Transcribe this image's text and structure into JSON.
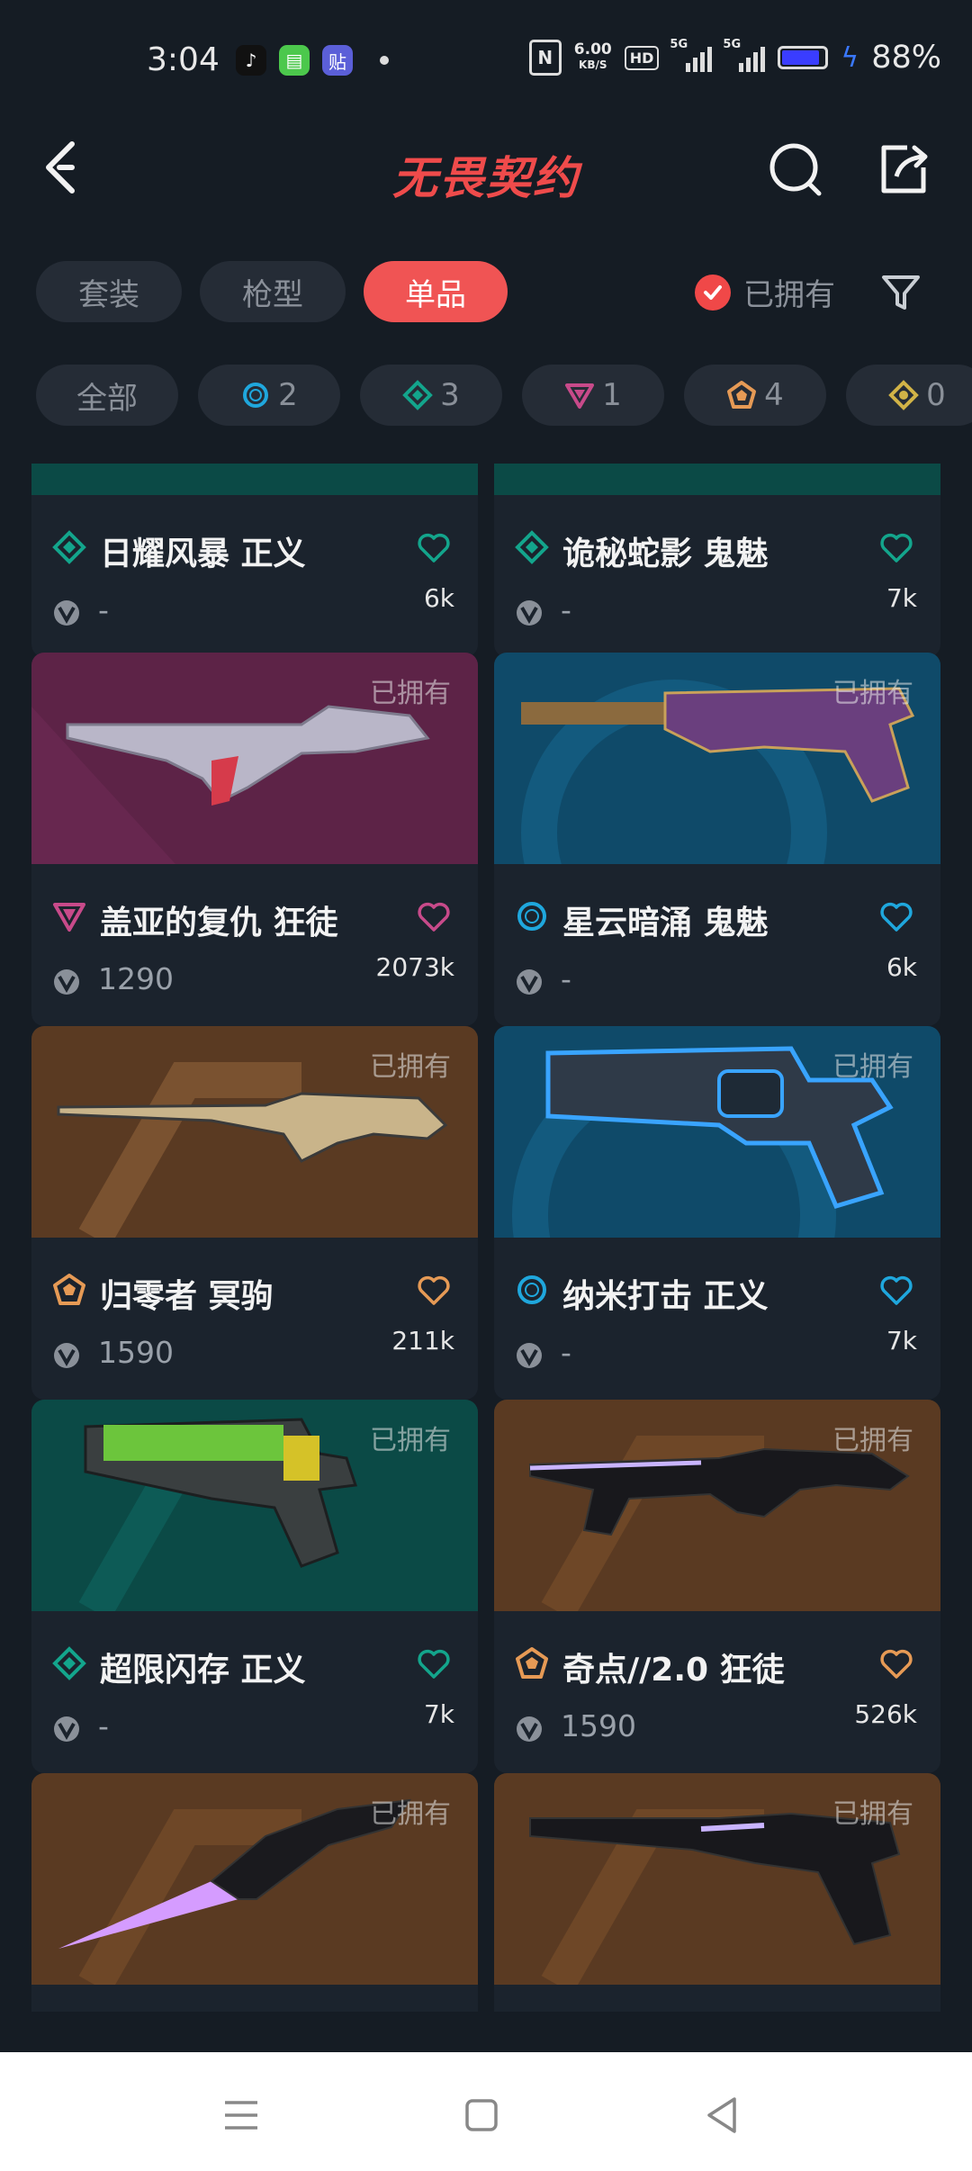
{
  "status_bar": {
    "time": "3:04",
    "speed_value": "6.00",
    "speed_unit": "KB/S",
    "hd_label": "HD",
    "network_1": "5G",
    "network_2": "5G",
    "battery_level": 0.88,
    "battery_text": "88%"
  },
  "header": {
    "title": "无畏契约"
  },
  "tabs": [
    {
      "label": "套装",
      "active": false
    },
    {
      "label": "枪型",
      "active": false
    },
    {
      "label": "单品",
      "active": true
    }
  ],
  "owned_filter": {
    "label": "已拥有",
    "checked": true
  },
  "rarity_chips": [
    {
      "label": "全部",
      "count": ""
    },
    {
      "label": "",
      "count": "2",
      "tier": "select"
    },
    {
      "label": "",
      "count": "3",
      "tier": "deluxe"
    },
    {
      "label": "",
      "count": "1",
      "tier": "premium"
    },
    {
      "label": "",
      "count": "4",
      "tier": "exclusive"
    },
    {
      "label": "",
      "count": "0",
      "tier": "ultra"
    }
  ],
  "colors": {
    "select": "#1fa7dd",
    "deluxe": "#13a58c",
    "premium": "#c84a8a",
    "exclusive": "#e69a55",
    "ultra": "#d1b347",
    "accent": "#f05454"
  },
  "items": [
    {
      "name": "日耀风暴 正义",
      "tier": "deluxe",
      "price": "-",
      "likes": "6k",
      "owned_label": ""
    },
    {
      "name": "诡秘蛇影 鬼魅",
      "tier": "deluxe",
      "price": "-",
      "likes": "7k",
      "owned_label": ""
    },
    {
      "name": "盖亚的复仇 狂徒",
      "tier": "premium",
      "price": "1290",
      "likes": "2073k",
      "owned_label": "已拥有"
    },
    {
      "name": "星云暗涌 鬼魅",
      "tier": "select",
      "price": "-",
      "likes": "6k",
      "owned_label": "已拥有"
    },
    {
      "name": "归零者 冥驹",
      "tier": "exclusive",
      "price": "1590",
      "likes": "211k",
      "owned_label": "已拥有"
    },
    {
      "name": "纳米打击 正义",
      "tier": "select",
      "price": "-",
      "likes": "7k",
      "owned_label": "已拥有"
    },
    {
      "name": "超限闪存 正义",
      "tier": "deluxe",
      "price": "-",
      "likes": "7k",
      "owned_label": "已拥有"
    },
    {
      "name": "奇点//2.0 狂徒",
      "tier": "exclusive",
      "price": "1590",
      "likes": "526k",
      "owned_label": "已拥有"
    },
    {
      "name": "",
      "tier": "exclusive",
      "price": "",
      "likes": "",
      "owned_label": "已拥有"
    },
    {
      "name": "",
      "tier": "exclusive",
      "price": "",
      "likes": "",
      "owned_label": "已拥有"
    }
  ]
}
